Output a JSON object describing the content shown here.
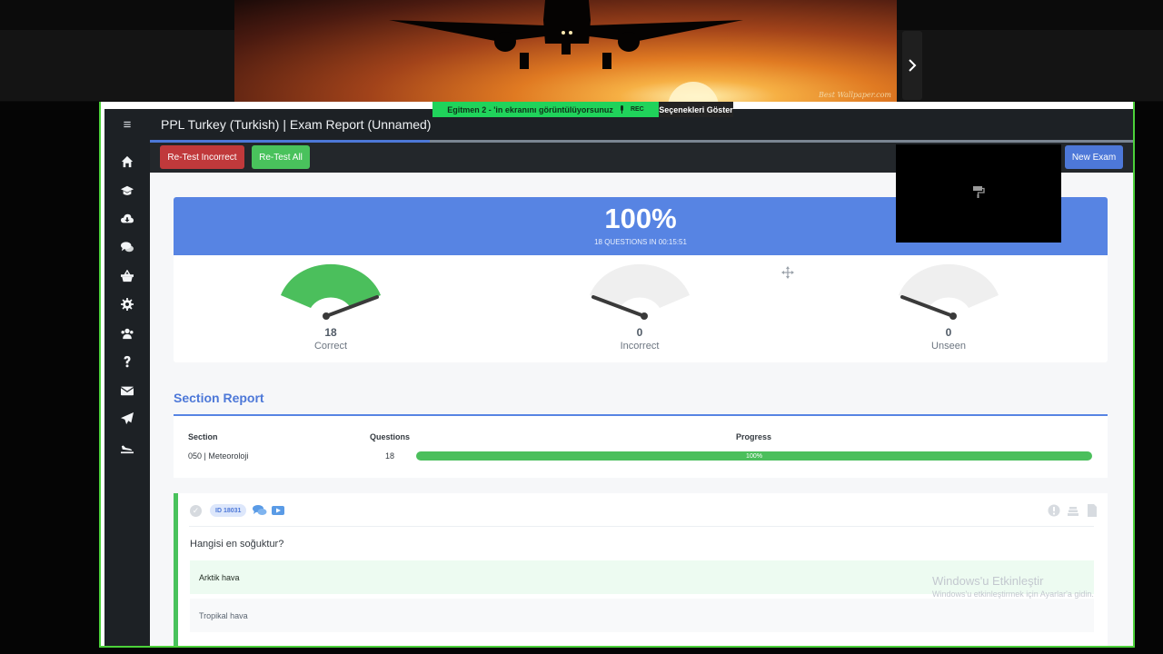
{
  "top_share": {
    "watermark": "Best Wallpaper.com",
    "next_icon": "chevron-right-icon"
  },
  "screen_share": {
    "banner_text": "Egitmen 2 - 'in ekranını görüntülüyorsunuz",
    "rec_label": "REC",
    "options_label": "Seçenekleri Göster"
  },
  "header": {
    "title": "PPL Turkey (Turkish) | Exam Report (Unnamed)"
  },
  "toolbar": {
    "retest_incorrect": "Re-Test Incorrect",
    "retest_all": "Re-Test All",
    "new_exam": "New Exam"
  },
  "sidebar": {
    "menu_icon": "≡",
    "items": [
      "home-icon",
      "graduation-cap-icon",
      "cloud-download-icon",
      "comments-icon",
      "basket-icon",
      "gear-icon",
      "users-icon",
      "question-icon",
      "envelope-icon",
      "paper-plane-icon",
      "plane-landing-icon"
    ]
  },
  "score": {
    "percent": "100%",
    "summary": "18 QUESTIONS IN 00:15:51",
    "gauges": [
      {
        "value": "18",
        "label": "Correct",
        "fraction": 1.0
      },
      {
        "value": "0",
        "label": "Incorrect",
        "fraction": 0.0
      },
      {
        "value": "0",
        "label": "Unseen",
        "fraction": 0.0
      }
    ]
  },
  "section_report": {
    "title": "Section Report",
    "headers": {
      "section": "Section",
      "questions": "Questions",
      "progress": "Progress"
    },
    "rows": [
      {
        "section": "050 | Meteoroloji",
        "questions": "18",
        "progress_label": "100%",
        "progress": 1.0
      }
    ]
  },
  "question": {
    "id": "ID 18031",
    "text": "Hangisi en soğuktur?",
    "answers": [
      {
        "text": "Arktik hava",
        "correct": true
      },
      {
        "text": "Tropikal hava",
        "correct": false
      }
    ]
  },
  "windows_activation": {
    "title": "Windows'u Etkinleştir",
    "subtitle": "Windows'u etkinleştirmek için Ayarlar'a gidin."
  },
  "colors": {
    "accent": "#5784e3",
    "success": "#49c25c",
    "danger": "#c0393b",
    "sidebar": "#1d2125",
    "frame": "#4cd13a"
  }
}
